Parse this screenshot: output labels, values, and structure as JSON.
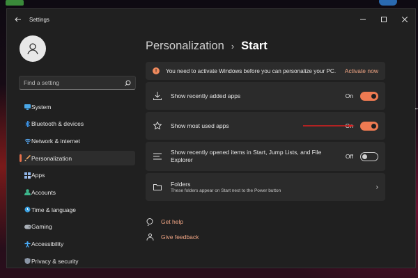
{
  "window": {
    "title": "Settings"
  },
  "search": {
    "placeholder": "Find a setting"
  },
  "sidebar": {
    "items": [
      {
        "label": "System",
        "icon": "monitor-icon",
        "color": "#4aa8e8"
      },
      {
        "label": "Bluetooth & devices",
        "icon": "bluetooth-icon",
        "color": "#3b8fe0"
      },
      {
        "label": "Network & internet",
        "icon": "wifi-icon",
        "color": "#5ab0ff"
      },
      {
        "label": "Personalization",
        "icon": "brush-icon",
        "color": "#e8a060",
        "active": true
      },
      {
        "label": "Apps",
        "icon": "apps-icon",
        "color": "#8fb4e8"
      },
      {
        "label": "Accounts",
        "icon": "person-icon",
        "color": "#3cb58a"
      },
      {
        "label": "Time & language",
        "icon": "globe-clock-icon",
        "color": "#3aa0e0"
      },
      {
        "label": "Gaming",
        "icon": "controller-icon",
        "color": "#aab0b8"
      },
      {
        "label": "Accessibility",
        "icon": "accessibility-icon",
        "color": "#4ab0ff"
      },
      {
        "label": "Privacy & security",
        "icon": "shield-icon",
        "color": "#8a96a6"
      }
    ]
  },
  "main": {
    "breadcrumb_parent": "Personalization",
    "breadcrumb_sep": "›",
    "breadcrumb_current": "Start",
    "warning": {
      "text": "You need to activate Windows before you can personalize your PC.",
      "link": "Activate now"
    },
    "settings": [
      {
        "label": "Show recently added apps",
        "state": "On"
      },
      {
        "label": "Show most used apps",
        "state": "On"
      },
      {
        "label": "Show recently opened items in Start, Jump Lists, and File Explorer",
        "state": "Off"
      }
    ],
    "folders": {
      "title": "Folders",
      "subtitle": "These folders appear on Start next to the Power button"
    },
    "help": {
      "get_help": "Get help",
      "give_feedback": "Give feedback"
    }
  },
  "colors": {
    "accent": "#ee7a52",
    "annotation_arrow": "#e02020"
  }
}
